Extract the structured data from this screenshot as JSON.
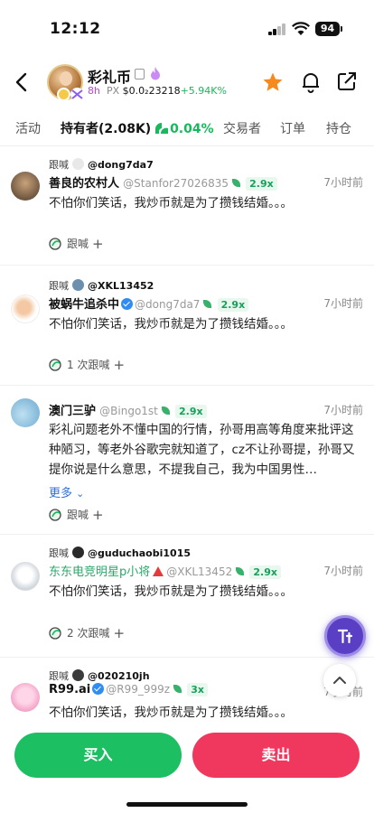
{
  "status_bar": {
    "time": "12:12",
    "battery": "94"
  },
  "header": {
    "coin_name": "彩礼币",
    "age": "8h",
    "price_label": "PX",
    "price_value": "$0.0₂23218",
    "price_change": "+5.94K%"
  },
  "tabs": [
    {
      "label": "活动"
    },
    {
      "label": "持有者",
      "count": "(2.08K)",
      "pct": "0.04%"
    },
    {
      "label": "交易者"
    },
    {
      "label": "订单"
    },
    {
      "label": "持仓"
    }
  ],
  "posts": [
    {
      "follow_label": "跟喊",
      "follow_handle": "@dong7da7",
      "name": "善良的农村人",
      "handle": "@Stanfor27026835",
      "mult": "2.9x",
      "time": "7小时前",
      "text": "不怕你们笑话，我炒币就是为了攒钱结婚。。。",
      "action": "跟喊"
    },
    {
      "follow_label": "跟喊",
      "follow_handle": "@XKL13452",
      "name": "被蜗牛追杀中",
      "handle": "@dong7da7",
      "mult": "2.9x",
      "time": "7小时前",
      "text": "不怕你们笑话，我炒币就是为了攒钱结婚。。。",
      "action": "1 次跟喊"
    },
    {
      "name": "澳门三驴",
      "handle": "@Bingo1st",
      "mult": "2.9x",
      "time": "7小时前",
      "text": "彩礼问题老外不懂中国的行情，孙哥用高等角度来批评这种陋习，等老外谷歌完就知道了，cz不让孙哥提，孙哥又提你说是什么意思，不提我自己，我为中国男性…",
      "more": "更多",
      "action": "跟喊"
    },
    {
      "follow_label": "跟喊",
      "follow_handle": "@guduchaobi1015",
      "name": "东东电竞明星p小将",
      "handle": "@XKL13452",
      "mult": "2.9x",
      "time": "7小时前",
      "text": "不怕你们笑话，我炒币就是为了攒钱结婚。。。",
      "action": "2 次跟喊"
    },
    {
      "follow_label": "跟喊",
      "follow_handle": "@020210jh",
      "name": "R99.ai",
      "handle": "@R99_999z",
      "mult": "3x",
      "time": "7小时前",
      "text": "不怕你们笑话，我炒币就是为了攒钱结婚。。。"
    }
  ],
  "buttons": {
    "buy": "买入",
    "sell": "卖出"
  },
  "colors": {
    "buy": "#1dbf63",
    "sell": "#f0385f",
    "accent_green": "#18b85c",
    "fab": "#5a3fc4"
  }
}
